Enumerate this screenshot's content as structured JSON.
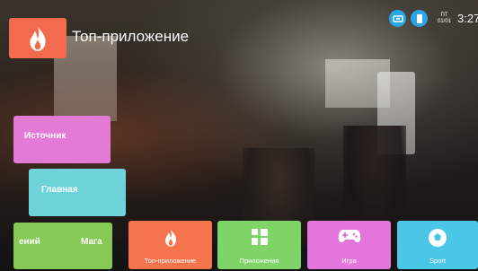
{
  "header": {
    "title": "Топ-приложение"
  },
  "status": {
    "date_top": "ПТ",
    "date_bottom": "01/01",
    "time": "3:27"
  },
  "sidebar": {
    "source_label": "Источник",
    "main_label": "Главная",
    "market_left": "ений",
    "market_right": "Мага"
  },
  "apps": [
    {
      "label": "Топ-приложение",
      "icon": "flame-icon"
    },
    {
      "label": "Приложения",
      "icon": "apps-grid-icon"
    },
    {
      "label": "Игра",
      "icon": "gamepad-icon"
    },
    {
      "label": "Sport",
      "icon": "soccer-ball-icon"
    }
  ],
  "colors": {
    "top_app": "#f26b4e",
    "source": "#e37bd6",
    "main": "#6fd3da",
    "market": "#86c954",
    "apps": "#7fd467",
    "game": "#e276dd",
    "sport": "#4ac7e6",
    "status_icons": "#2aa6e6"
  }
}
